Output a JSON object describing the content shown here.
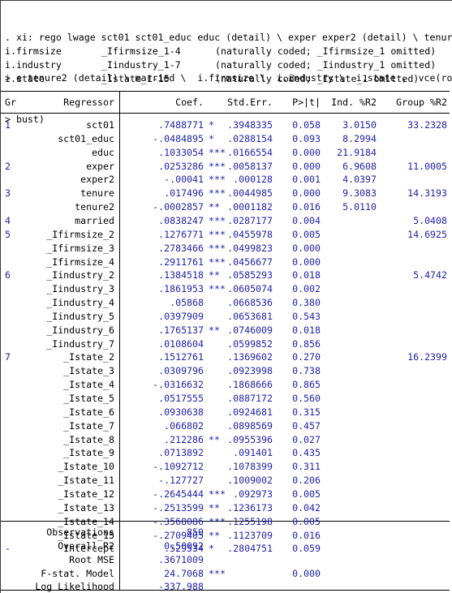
{
  "console": {
    "command_lines": [
      ". xi: rego lwage sct01 sct01_educ educ (detail) \\ exper exper2 (detail) \\ tenur",
      "> e tenure2 (detail) \\ married \\  i.firmsize \\  i.industry \\  i.state ,  vce(ro",
      "> bust)"
    ],
    "xi_expansion": [
      {
        "varname": "i.firmsize",
        "dummies": "_Ifirmsize_1-4",
        "note": "(naturally coded; _Ifirmsize_1 omitted)"
      },
      {
        "varname": "i.industry",
        "dummies": "_Iindustry_1-7",
        "note": "(naturally coded; _Iindustry_1 omitted)"
      },
      {
        "varname": "i.state",
        "dummies": "_Istate_1-15",
        "note": "(naturally coded; _Istate_1 omitted)"
      }
    ]
  },
  "table": {
    "headers": {
      "group": "Gr",
      "regressor": "Regressor",
      "coef": "Coef.",
      "stderr": "Std.Err.",
      "pvalue": "P>|t|",
      "ind_r2": "Ind. %R2",
      "group_r2": "Group %R2"
    },
    "rows": [
      {
        "gr": "1",
        "name": "sct01",
        "coef": ".7488771",
        "stars": "*",
        "se": ".3948335",
        "p": "0.058",
        "ind": "3.0150",
        "grp": "33.2328"
      },
      {
        "gr": "",
        "name": "sct01_educ",
        "coef": "-.0484895",
        "stars": "*",
        "se": ".0288154",
        "p": "0.093",
        "ind": "8.2994",
        "grp": ""
      },
      {
        "gr": "",
        "name": "educ",
        "coef": ".1033054",
        "stars": "***",
        "se": ".0166554",
        "p": "0.000",
        "ind": "21.9184",
        "grp": ""
      },
      {
        "gr": "2",
        "name": "exper",
        "coef": ".0253286",
        "stars": "***",
        "se": ".0058137",
        "p": "0.000",
        "ind": "6.9608",
        "grp": "11.0005"
      },
      {
        "gr": "",
        "name": "exper2",
        "coef": "-.00041",
        "stars": "***",
        "se": ".000128",
        "p": "0.001",
        "ind": "4.0397",
        "grp": ""
      },
      {
        "gr": "3",
        "name": "tenure",
        "coef": ".017496",
        "stars": "***",
        "se": ".0044985",
        "p": "0.000",
        "ind": "9.3083",
        "grp": "14.3193"
      },
      {
        "gr": "",
        "name": "tenure2",
        "coef": "-.0002857",
        "stars": "**",
        "se": ".0001182",
        "p": "0.016",
        "ind": "5.0110",
        "grp": ""
      },
      {
        "gr": "4",
        "name": "married",
        "coef": ".0838247",
        "stars": "***",
        "se": ".0287177",
        "p": "0.004",
        "ind": "",
        "grp": "5.0408"
      },
      {
        "gr": "5",
        "name": "_Ifirmsize_2",
        "coef": ".1276771",
        "stars": "***",
        "se": ".0455978",
        "p": "0.005",
        "ind": "",
        "grp": "14.6925"
      },
      {
        "gr": "",
        "name": "_Ifirmsize_3",
        "coef": ".2783466",
        "stars": "***",
        "se": ".0499823",
        "p": "0.000",
        "ind": "",
        "grp": ""
      },
      {
        "gr": "",
        "name": "_Ifirmsize_4",
        "coef": ".2911761",
        "stars": "***",
        "se": ".0456677",
        "p": "0.000",
        "ind": "",
        "grp": ""
      },
      {
        "gr": "6",
        "name": "_Iindustry_2",
        "coef": ".1384518",
        "stars": "**",
        "se": ".0585293",
        "p": "0.018",
        "ind": "",
        "grp": "5.4742"
      },
      {
        "gr": "",
        "name": "_Iindustry_3",
        "coef": ".1861953",
        "stars": "***",
        "se": ".0605074",
        "p": "0.002",
        "ind": "",
        "grp": ""
      },
      {
        "gr": "",
        "name": "_Iindustry_4",
        "coef": ".05868",
        "stars": "",
        "se": ".0668536",
        "p": "0.380",
        "ind": "",
        "grp": ""
      },
      {
        "gr": "",
        "name": "_Iindustry_5",
        "coef": ".0397909",
        "stars": "",
        "se": ".0653681",
        "p": "0.543",
        "ind": "",
        "grp": ""
      },
      {
        "gr": "",
        "name": "_Iindustry_6",
        "coef": ".1765137",
        "stars": "**",
        "se": ".0746009",
        "p": "0.018",
        "ind": "",
        "grp": ""
      },
      {
        "gr": "",
        "name": "_Iindustry_7",
        "coef": ".0108604",
        "stars": "",
        "se": ".0599852",
        "p": "0.856",
        "ind": "",
        "grp": ""
      },
      {
        "gr": "7",
        "name": "_Istate_2",
        "coef": ".1512761",
        "stars": "",
        "se": ".1369602",
        "p": "0.270",
        "ind": "",
        "grp": "16.2399"
      },
      {
        "gr": "",
        "name": "_Istate_3",
        "coef": ".0309796",
        "stars": "",
        "se": ".0923998",
        "p": "0.738",
        "ind": "",
        "grp": ""
      },
      {
        "gr": "",
        "name": "_Istate_4",
        "coef": "-.0316632",
        "stars": "",
        "se": ".1868666",
        "p": "0.865",
        "ind": "",
        "grp": ""
      },
      {
        "gr": "",
        "name": "_Istate_5",
        "coef": ".0517555",
        "stars": "",
        "se": ".0887172",
        "p": "0.560",
        "ind": "",
        "grp": ""
      },
      {
        "gr": "",
        "name": "_Istate_6",
        "coef": ".0930638",
        "stars": "",
        "se": ".0924681",
        "p": "0.315",
        "ind": "",
        "grp": ""
      },
      {
        "gr": "",
        "name": "_Istate_7",
        "coef": ".066802",
        "stars": "",
        "se": ".0898569",
        "p": "0.457",
        "ind": "",
        "grp": ""
      },
      {
        "gr": "",
        "name": "_Istate_8",
        "coef": ".212286",
        "stars": "**",
        "se": ".0955396",
        "p": "0.027",
        "ind": "",
        "grp": ""
      },
      {
        "gr": "",
        "name": "_Istate_9",
        "coef": ".0713892",
        "stars": "",
        "se": ".091401",
        "p": "0.435",
        "ind": "",
        "grp": ""
      },
      {
        "gr": "",
        "name": "_Istate_10",
        "coef": "-.1092712",
        "stars": "",
        "se": ".1078399",
        "p": "0.311",
        "ind": "",
        "grp": ""
      },
      {
        "gr": "",
        "name": "_Istate_11",
        "coef": "-.127727",
        "stars": "",
        "se": ".1009002",
        "p": "0.206",
        "ind": "",
        "grp": ""
      },
      {
        "gr": "",
        "name": "_Istate_12",
        "coef": "-.2645444",
        "stars": "***",
        "se": ".092973",
        "p": "0.005",
        "ind": "",
        "grp": ""
      },
      {
        "gr": "",
        "name": "_Istate_13",
        "coef": "-.2513599",
        "stars": "**",
        "se": ".1236173",
        "p": "0.042",
        "ind": "",
        "grp": ""
      },
      {
        "gr": "",
        "name": "_Istate_14",
        "coef": "-.3568086",
        "stars": "***",
        "se": ".1255198",
        "p": "0.005",
        "ind": "",
        "grp": ""
      },
      {
        "gr": "",
        "name": "_Istate_15",
        "coef": "-.2709405",
        "stars": "**",
        "se": ".1123709",
        "p": "0.016",
        "ind": "",
        "grp": ""
      },
      {
        "gr": "-",
        "name": "Intercept",
        "coef": ".529534",
        "stars": "*",
        "se": ".2804751",
        "p": "0.059",
        "ind": "",
        "grp": ""
      }
    ],
    "summary": [
      {
        "label": "Observations",
        "value": "850",
        "stars": "",
        "p": ""
      },
      {
        "label": "Overall R2",
        "value": "0.50092",
        "stars": "",
        "p": ""
      },
      {
        "label": "Root MSE",
        "value": ".3671009",
        "stars": "",
        "p": ""
      },
      {
        "label": "F-stat. Model",
        "value": "24.7068",
        "stars": "***",
        "p": "0.000"
      },
      {
        "label": "Log Likelihood",
        "value": "-337.988",
        "stars": "",
        "p": ""
      }
    ]
  },
  "colors": {
    "text": "#000000",
    "numbers": "#2222aa",
    "background": "#ffffff",
    "rule": "#000000"
  }
}
